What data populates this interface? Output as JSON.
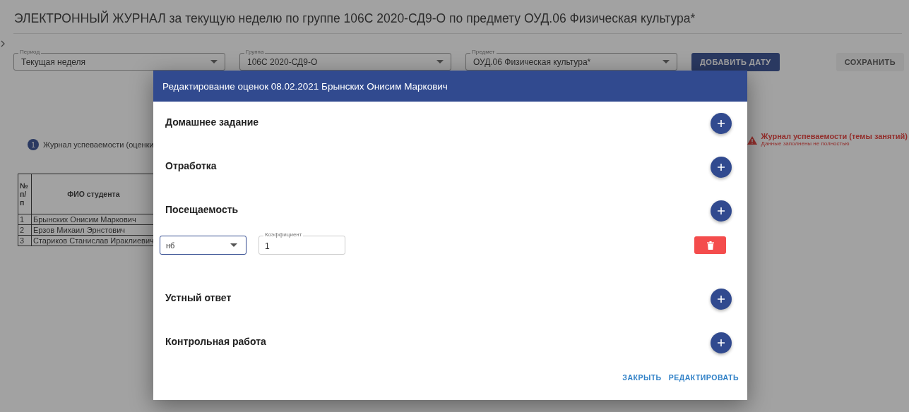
{
  "page_title": "ЭЛЕКТРОННЫЙ ЖУРНАЛ за текущую неделю по группе 106С 2020-СД9-О по предмету ОУД.06 Физическая культура*",
  "filters": [
    {
      "label": "Период",
      "value": "Текущая неделя"
    },
    {
      "label": "Группа",
      "value": "106С 2020-СД9-О"
    },
    {
      "label": "Предмет",
      "value": "ОУД.06 Физическая культура*"
    }
  ],
  "buttons": [
    {
      "label": "ДОБАВИТЬ ДАТУ",
      "disabled": false
    },
    {
      "label": "СОХРАНИТЬ",
      "disabled": true
    }
  ],
  "steps": [
    {
      "kind": "step",
      "number": "1",
      "label": "Журнал успеваемости (оценки"
    },
    {
      "kind": "warning",
      "label": "Журнал успеваемости (темы занятий)",
      "sublabel": "Данные заполнены не полностью"
    }
  ],
  "table": {
    "columns": [
      "№ п/п",
      "ФИО студента"
    ],
    "rows": [
      [
        "1",
        "Брынских Онисим Маркович"
      ],
      [
        "2",
        "Ерзов Михаил Эрнстович"
      ],
      [
        "3",
        "Стариков Станислав Ираклиевич"
      ]
    ]
  },
  "dialog": {
    "title": "Редактирование оценок 08.02.2021 Брынских Онисим Маркович",
    "sections": [
      {
        "title": "Домашнее задание"
      },
      {
        "title": "Отработка"
      },
      {
        "title": "Посещаемость",
        "entries": [
          {
            "grade": "нб",
            "coefficient_label": "Коэффициент",
            "coefficient": "1"
          }
        ]
      },
      {
        "title": "Устный ответ"
      },
      {
        "title": "Контрольная работа"
      }
    ],
    "actions": [
      "ЗАКРЫТЬ",
      "РЕДАКТИРОВАТЬ"
    ]
  }
}
